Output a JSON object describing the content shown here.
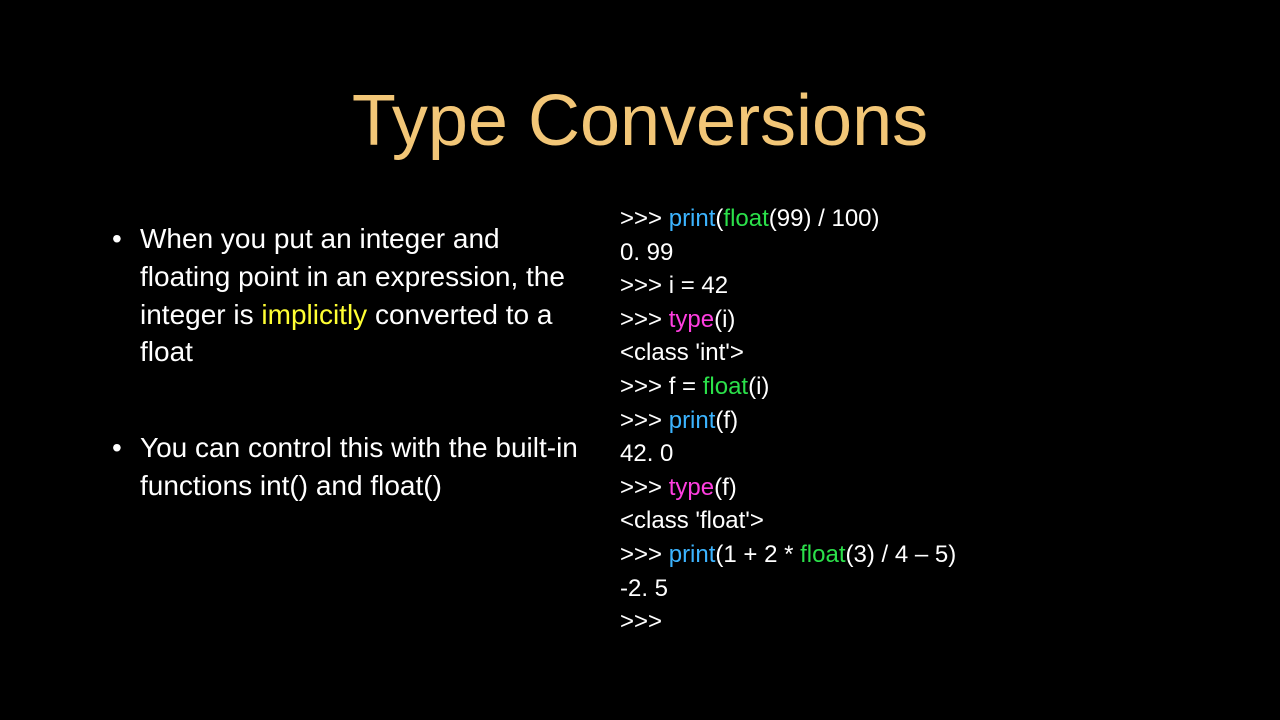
{
  "title": "Type Conversions",
  "bullets": {
    "b1_pre": "When you put an integer and floating point in an expression, the integer is ",
    "b1_hl": "implicitly",
    "b1_post": " converted to a float",
    "b2": "You can control this with the built-in functions int() and float()"
  },
  "code": {
    "l1a": ">>> ",
    "l1b": "print",
    "l1c": "(",
    "l1d": "float",
    "l1e": "(99) / 100)",
    "l2": "0. 99",
    "l3": ">>> i = 42",
    "l4a": ">>> ",
    "l4b": "type",
    "l4c": "(i)",
    "l5": "<class 'int'>",
    "l6a": ">>> f = ",
    "l6b": "float",
    "l6c": "(i)",
    "l7a": ">>> ",
    "l7b": "print",
    "l7c": "(f)",
    "l8": "42. 0",
    "l9a": ">>> ",
    "l9b": "type",
    "l9c": "(f)",
    "l10": "<class 'float'>",
    "l11a": ">>> ",
    "l11b": "print",
    "l11c": "(1 + 2 * ",
    "l11d": "float",
    "l11e": "(3) / 4 – 5)",
    "l12": "-2. 5",
    "l13": ">>>"
  }
}
